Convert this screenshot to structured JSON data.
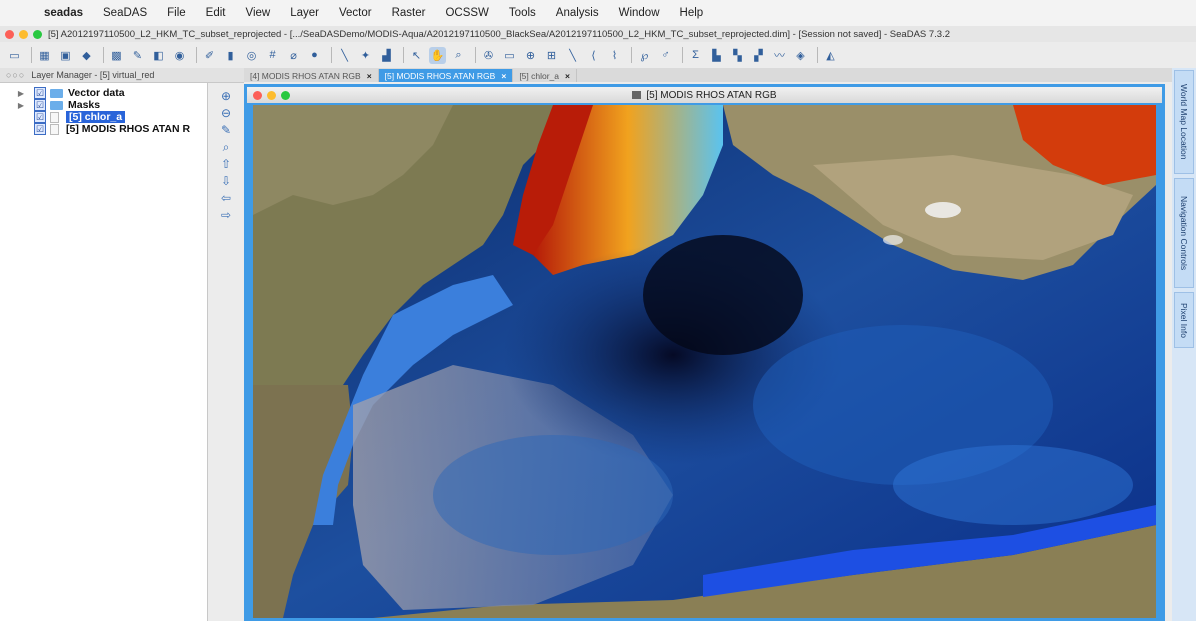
{
  "menubar": {
    "apple": "",
    "items": [
      "seadas",
      "SeaDAS",
      "File",
      "Edit",
      "View",
      "Layer",
      "Vector",
      "Raster",
      "OCSSW",
      "Tools",
      "Analysis",
      "Window",
      "Help"
    ]
  },
  "window": {
    "title": "[5] A2012197110500_L2_HKM_TC_subset_reprojected - [.../SeaDASDemo/MODIS-Aqua/A2012197110500_BlackSea/A2012197110500_L2_HKM_TC_subset_reprojected.dim] - [Session not saved] - SeaDAS 7.3.2"
  },
  "layer_manager": {
    "title": "Layer Manager - [5] virtual_red",
    "nodes": [
      {
        "label": "Vector data",
        "checked": "☑"
      },
      {
        "label": "Masks",
        "checked": "☑"
      },
      {
        "label": "[5] chlor_a",
        "checked": "☑"
      },
      {
        "label": "[5] MODIS RHOS ATAN R",
        "checked": "☑"
      }
    ]
  },
  "tabs": [
    {
      "label": "[4] MODIS RHOS ATAN RGB",
      "close": "×"
    },
    {
      "label": "[5] MODIS RHOS ATAN RGB",
      "close": "×"
    },
    {
      "label": "[5] chlor_a",
      "close": "×"
    }
  ],
  "frame": {
    "title": "[5] MODIS RHOS ATAN RGB"
  },
  "side_tabs": [
    "World Map Location",
    "Navigation Controls",
    "Pixel Info"
  ],
  "colors": {
    "accent": "#3f9be6",
    "selection": "#2964d9"
  }
}
